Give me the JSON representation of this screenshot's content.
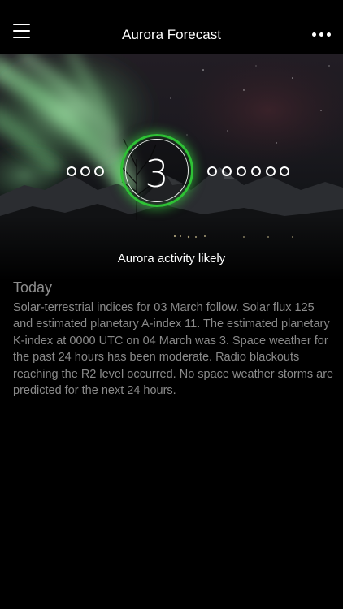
{
  "header": {
    "title": "Aurora Forecast"
  },
  "kp": {
    "value": "3",
    "dots_before": 3,
    "dots_after": 6,
    "ring_color": "#2ec235"
  },
  "hero": {
    "status_text": "Aurora activity likely"
  },
  "forecast": {
    "title": "Today",
    "text": "Solar-terrestrial indices for 03 March follow. Solar flux 125 and estimated planetary A-index 11. The estimated planetary K-index at 0000 UTC on 04 March was 3. Space weather for the past 24 hours has been moderate. Radio blackouts reaching the R2 level occurred. No space weather storms are predicted for the next 24 hours."
  },
  "icons": {
    "menu": "hamburger-menu-icon",
    "more": "more-dots-icon"
  }
}
